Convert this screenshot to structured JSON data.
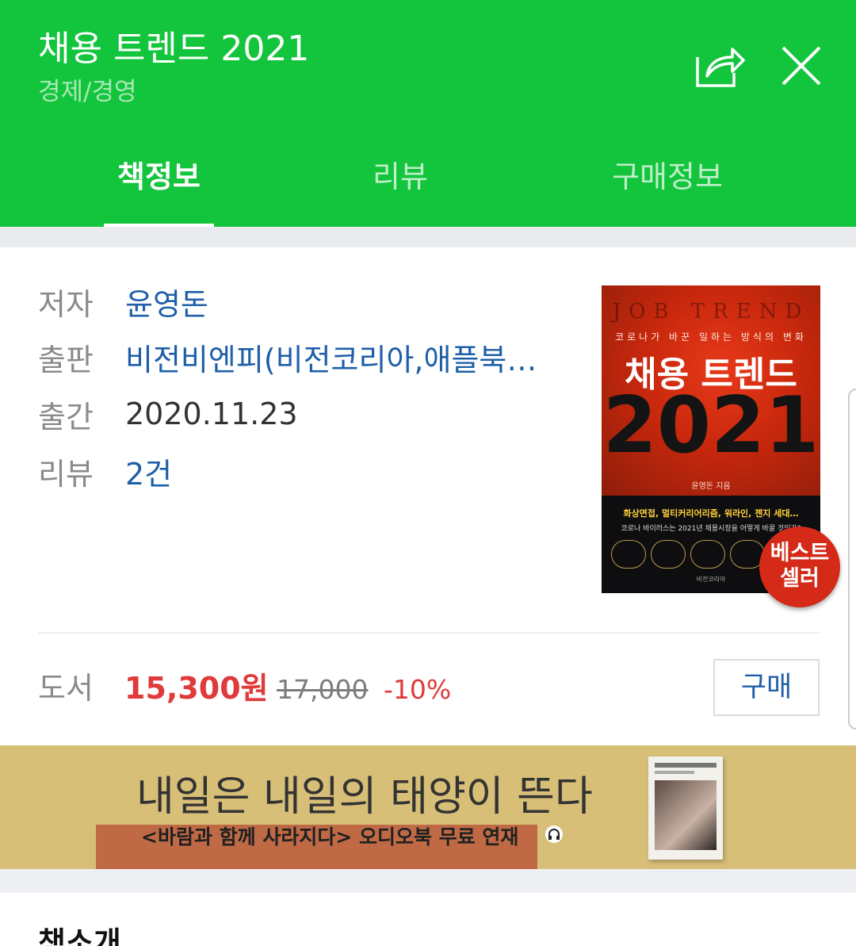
{
  "header": {
    "title": "채용 트렌드 2021",
    "category": "경제/경영",
    "share_icon": "share-icon",
    "close_icon": "close-icon"
  },
  "tabs": [
    {
      "label": "책정보",
      "active": true
    },
    {
      "label": "리뷰",
      "active": false
    },
    {
      "label": "구매정보",
      "active": false
    }
  ],
  "info": {
    "author_label": "저자",
    "author": "윤영돈",
    "publisher_label": "출판",
    "publisher": "비전비엔피(비전코리아,애플북…",
    "date_label": "출간",
    "date": "2020.11.23",
    "review_label": "리뷰",
    "review_count": "2건"
  },
  "cover": {
    "series_text": "JOB TREND",
    "subtitle": "코로나가 바꾼 일하는 방식의 변화",
    "title": "채용 트렌드",
    "year": "2021",
    "author_text": "윤영돈 지음",
    "line1": "화상면접, 멀티커리어리즘, 워라인, 젠지 세대…",
    "line2": "코로나 바이러스는 2021년 채용시장을 어떻게 바꿀 것인가?",
    "publisher_mark": "비전코리아"
  },
  "badge": {
    "line1": "베스트",
    "line2": "셀러"
  },
  "price": {
    "label": "도서",
    "sale": "15,300원",
    "original": "17,000",
    "discount": "-10%",
    "buy_label": "구매"
  },
  "banner": {
    "title": "내일은 내일의 태양이 뜬다",
    "subtitle": "<바람과 함께 사라지다> 오디오북 무료 연재"
  },
  "intro": {
    "title": "책소개"
  },
  "colors": {
    "header_green": "#13c53c",
    "link_blue": "#1e5fa8",
    "price_red": "#e03a3a",
    "banner_gold": "#d8bf78"
  }
}
